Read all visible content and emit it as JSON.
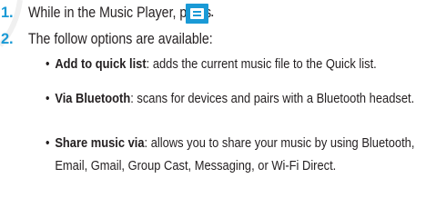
{
  "steps": [
    {
      "number": "1.",
      "text": "While in the Music Player, press",
      "trailing": "."
    },
    {
      "number": "2.",
      "text": "The follow options are available:"
    }
  ],
  "menu_key_icon": "menu-key-icon",
  "accent_color": "#1a9ad6",
  "options": [
    {
      "term": "Add to quick list",
      "description": ": adds the current music file to the Quick list."
    },
    {
      "term": "Via Bluetooth",
      "description": ": scans for devices and pairs with a Bluetooth headset."
    },
    {
      "term": "Share music via",
      "description": ": allows you to share your music by using Bluetooth, Email, Gmail, Group Cast, Messaging, or Wi-Fi Direct."
    }
  ]
}
